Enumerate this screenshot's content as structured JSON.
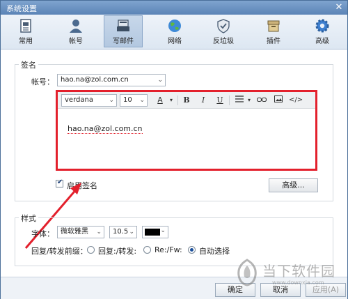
{
  "window": {
    "title": "系统设置",
    "close_glyph": "✕"
  },
  "toolbar": {
    "tabs": [
      {
        "label": "常用",
        "icon": "document-icon"
      },
      {
        "label": "帐号",
        "icon": "user-icon"
      },
      {
        "label": "写邮件",
        "icon": "compose-icon",
        "active": true
      },
      {
        "label": "网络",
        "icon": "globe-icon"
      },
      {
        "label": "反垃圾",
        "icon": "shield-icon"
      },
      {
        "label": "插件",
        "icon": "plugin-box-icon"
      },
      {
        "label": "高级",
        "icon": "gear-icon"
      }
    ]
  },
  "signature": {
    "group_title": "签名",
    "account_label": "帐号：",
    "account_value": "hao.na@zol.com.cn",
    "editor": {
      "font_value": "verdana",
      "size_value": "10",
      "color_button": "A",
      "bold": "B",
      "italic": "I",
      "underline": "U",
      "align_icon": "align-icon",
      "link_icon": "link-icon",
      "image_icon": "image-icon",
      "code_glyph": "</>",
      "content": "hao.na@zol.com.cn"
    },
    "enable_label": "启用签名",
    "enable_checked": true,
    "advanced_button": "高级..."
  },
  "style": {
    "group_title": "样式",
    "font_label": "字体：",
    "font_value": "微软雅黑",
    "size_value": "10.5",
    "color_value": "#000000",
    "prefix_label": "回复/转发前缀：",
    "options": [
      {
        "label": "回复:/转发:",
        "selected": false
      },
      {
        "label": "Re:/Fw:",
        "selected": false
      },
      {
        "label": "自动选择",
        "selected": true
      }
    ]
  },
  "footer": {
    "ok": "确定",
    "cancel": "取消",
    "apply": "应用(A)"
  },
  "watermark": {
    "text": "当下软件园",
    "url": "www.downxia.com"
  },
  "colors": {
    "accent": "#e3202c",
    "titlebar": "#5b84b6"
  }
}
